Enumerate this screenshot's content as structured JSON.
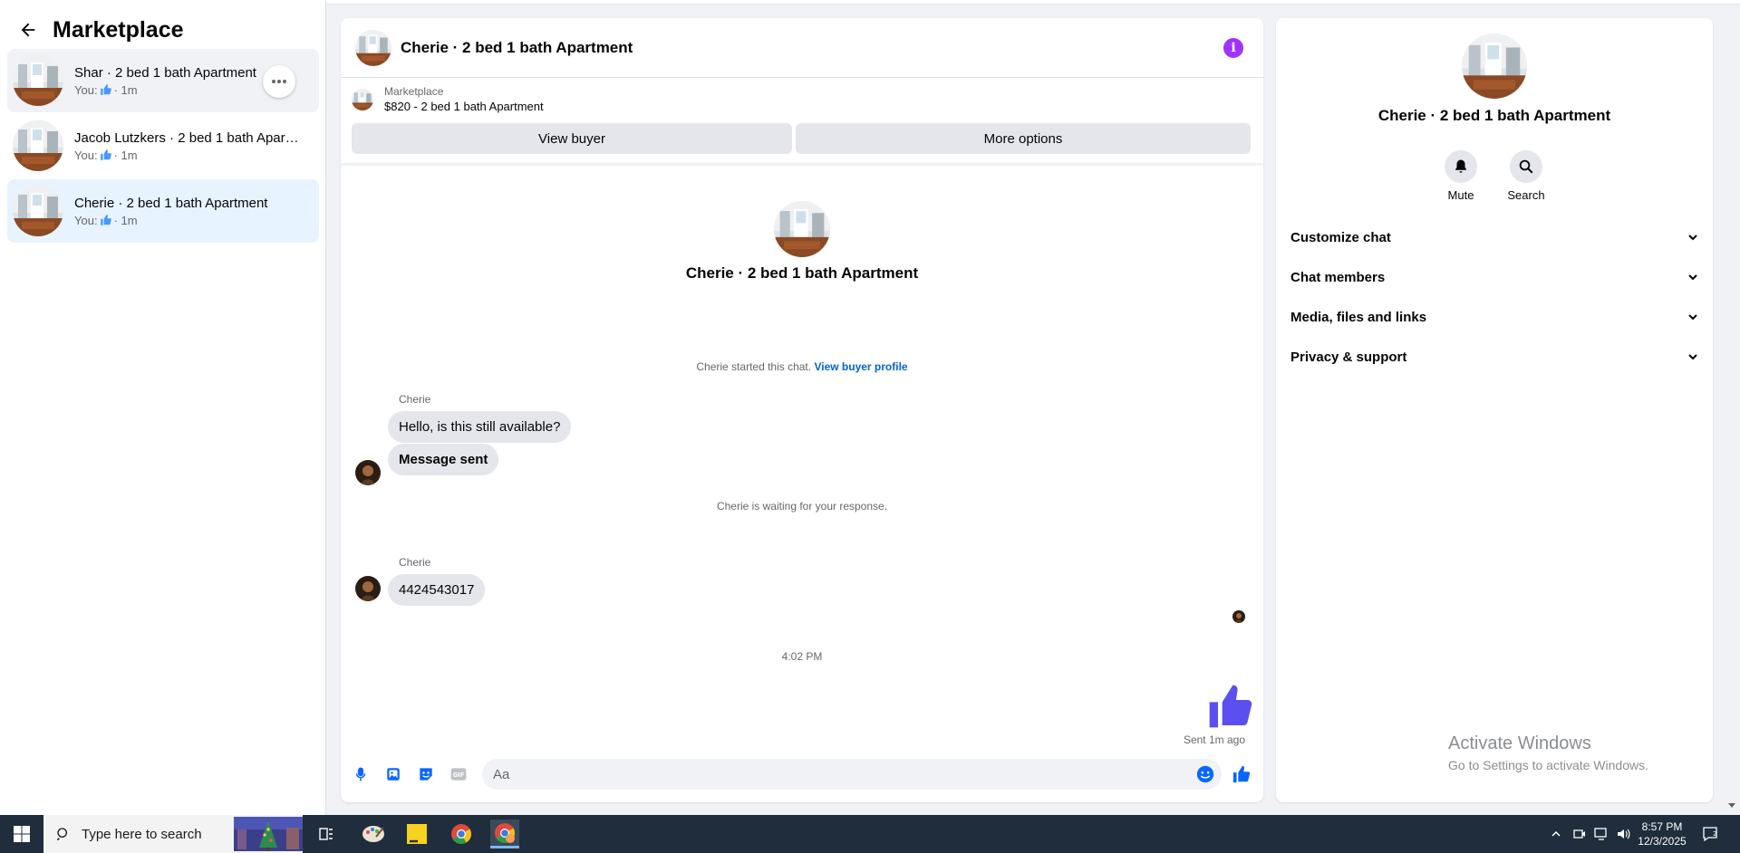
{
  "sidebar": {
    "title": "Marketplace",
    "conversations": [
      {
        "title": "Shar · 2 bed 1 bath Apartment",
        "you": "You:",
        "time": "· 1m"
      },
      {
        "title": "Jacob Lutzkers · 2 bed 1 bath Apartment",
        "you": "You:",
        "time": "· 1m"
      },
      {
        "title": "Cherie · 2 bed 1 bath Apartment",
        "you": "You:",
        "time": "· 1m"
      }
    ]
  },
  "chat": {
    "header_title": "Cherie · 2 bed 1 bath Apartment",
    "marketplace_label": "Marketplace",
    "listing": "$820 - 2 bed 1 bath Apartment",
    "view_buyer": "View buyer",
    "more_options": "More options",
    "intro_title": "Cherie · 2 bed 1 bath Apartment",
    "started_text": "Cherie started this chat.",
    "view_buyer_profile": "View buyer profile",
    "sender1": "Cherie",
    "msg1": "Hello, is this still available?",
    "msg2": "Message sent",
    "waiting_text": "Cherie is waiting for your response.",
    "sender2": "Cherie",
    "msg3": "4424543017",
    "time": "4:02 PM",
    "sent_status": "Sent 1m ago",
    "composer_placeholder": "Aa"
  },
  "panel": {
    "title": "Cherie · 2 bed 1 bath Apartment",
    "mute": "Mute",
    "search": "Search",
    "rows": [
      "Customize chat",
      "Chat members",
      "Media, files and links",
      "Privacy & support"
    ]
  },
  "watermark": {
    "line1": "Activate Windows",
    "line2": "Go to Settings to activate Windows."
  },
  "taskbar": {
    "search_placeholder": "Type here to search",
    "time": "8:57 PM",
    "date": "12/3/2025"
  },
  "colors": {
    "accent": "#0866ff",
    "active_row": "#e7f3ff",
    "info_purple": "#a033ff",
    "like_purple": "#5b4ff0"
  }
}
